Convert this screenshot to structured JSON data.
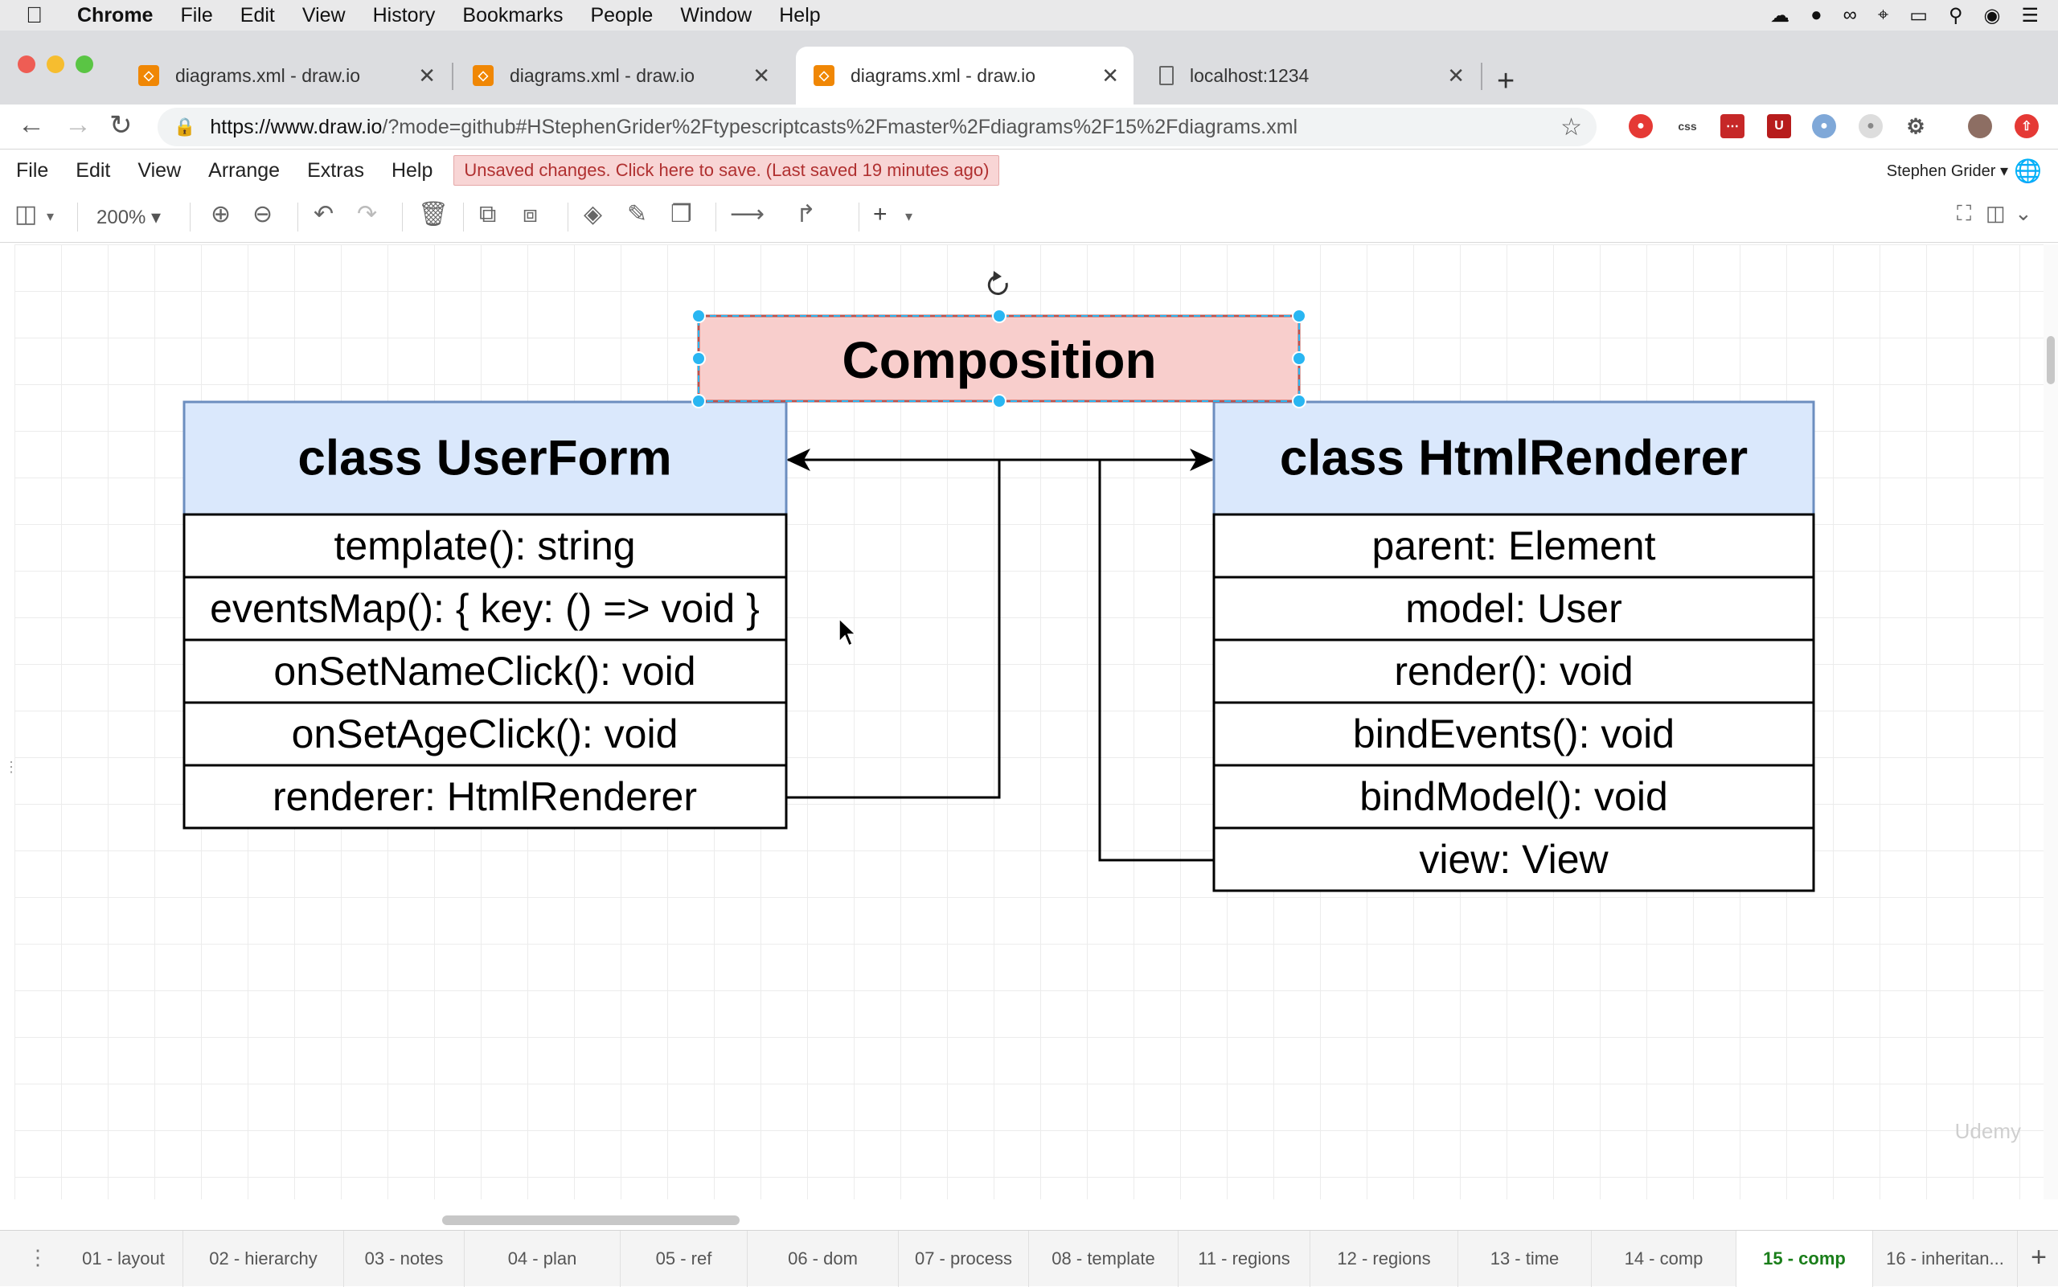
{
  "mac_menubar": {
    "app": "Chrome",
    "items": [
      "File",
      "Edit",
      "View",
      "History",
      "Bookmarks",
      "People",
      "Window",
      "Help"
    ]
  },
  "tabs": [
    {
      "title": "diagrams.xml - draw.io",
      "active": false
    },
    {
      "title": "diagrams.xml - draw.io",
      "active": false
    },
    {
      "title": "diagrams.xml - draw.io",
      "active": true
    },
    {
      "title": "localhost:1234",
      "active": false
    }
  ],
  "address": {
    "host": "https://www.draw.io",
    "rest": "/?mode=github#HStephenGrider%2Ftypescriptcasts%2Fmaster%2Fdiagrams%2F15%2Fdiagrams.xml"
  },
  "drawio_menu": {
    "items": [
      "File",
      "Edit",
      "View",
      "Arrange",
      "Extras",
      "Help"
    ],
    "unsaved": "Unsaved changes. Click here to save. (Last saved 19 minutes ago)",
    "account": "Stephen Grider"
  },
  "toolbar": {
    "zoom": "200%"
  },
  "diagram": {
    "title": "Composition",
    "left_class": {
      "name": "class UserForm",
      "rows": [
        "template(): string",
        "eventsMap(): { key: () => void }",
        "onSetNameClick(): void",
        "onSetAgeClick(): void",
        "renderer: HtmlRenderer"
      ]
    },
    "right_class": {
      "name": "class HtmlRenderer",
      "rows": [
        "parent: Element",
        "model: User",
        "render(): void",
        "bindEvents(): void",
        "bindModel(): void",
        "view: View"
      ]
    },
    "colors": {
      "header_fill": "#dae8fc",
      "header_stroke": "#6c8ebf",
      "title_fill": "#f8cecc",
      "title_stroke": "#b85450",
      "selection": "#29b6f2"
    }
  },
  "page_tabs": [
    {
      "label": "01 - layout",
      "active": false
    },
    {
      "label": "02 - hierarchy",
      "active": false
    },
    {
      "label": "03 - notes",
      "active": false
    },
    {
      "label": "04 - plan",
      "active": false
    },
    {
      "label": "05 - ref",
      "active": false
    },
    {
      "label": "06 - dom",
      "active": false
    },
    {
      "label": "07 - process",
      "active": false
    },
    {
      "label": "08 - template",
      "active": false
    },
    {
      "label": "11 - regions",
      "active": false
    },
    {
      "label": "12 - regions",
      "active": false
    },
    {
      "label": "13 - time",
      "active": false
    },
    {
      "label": "14 - comp",
      "active": false
    },
    {
      "label": "15 - comp",
      "active": true
    },
    {
      "label": "16 - inheritan...",
      "active": false
    }
  ],
  "watermark": "Udemy"
}
